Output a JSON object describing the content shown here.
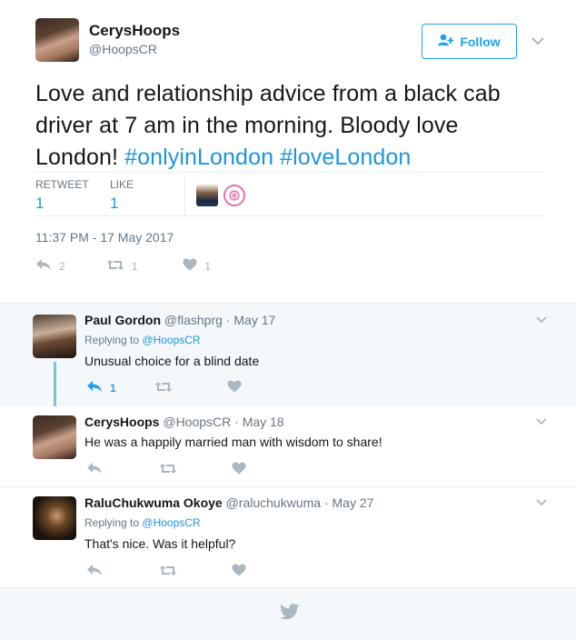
{
  "tweet": {
    "display_name": "CerysHoops",
    "handle": "@HoopsCR",
    "follow_label": "Follow",
    "text_plain": "Love and relationship advice from a black cab driver at 7 am in the morning. Bloody love London! ",
    "hashtag1": "#onlyinLondon",
    "hashtag2": "#loveLondon",
    "stats": {
      "retweet_label": "RETWEET",
      "retweet_value": "1",
      "like_label": "LIKE",
      "like_value": "1"
    },
    "timestamp": "11:37 PM - 17 May 2017",
    "actions": {
      "reply_count": "2",
      "retweet_count": "1",
      "like_count": "1"
    }
  },
  "replies": [
    {
      "name": "Paul Gordon",
      "handle": "@flashprg",
      "date": "· May 17",
      "replying_prefix": "Replying to",
      "replying_to": "@HoopsCR",
      "text": "Unusual choice for a blind date",
      "reply_count": "1"
    },
    {
      "name": "CerysHoops",
      "handle": "@HoopsCR",
      "date": "· May 18",
      "text": "He was a happily married man with wisdom to share!"
    },
    {
      "name": "RaluChukwuma Okoye",
      "handle": "@raluchukwuma",
      "date": "· May 27",
      "replying_prefix": "Replying to",
      "replying_to": "@HoopsCR",
      "text": "That's nice. Was it helpful?"
    }
  ],
  "colors": {
    "accent": "#1da1f2",
    "link": "#1b95e0",
    "muted": "#657786",
    "icon": "#aab8c2",
    "thread": "#78c6d0"
  },
  "icons": [
    "chevron-down-icon",
    "follow-icon",
    "reply-icon",
    "retweet-icon",
    "like-icon",
    "twitter-bird-icon"
  ]
}
